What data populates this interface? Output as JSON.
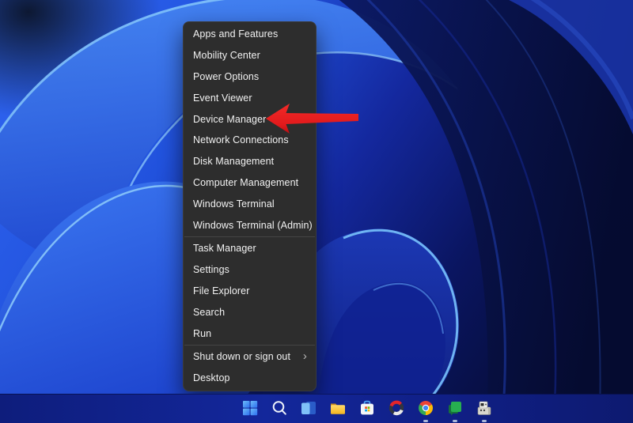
{
  "menu": {
    "items": [
      {
        "label": "Apps and Features"
      },
      {
        "label": "Mobility Center"
      },
      {
        "label": "Power Options"
      },
      {
        "label": "Event Viewer"
      },
      {
        "label": "Device Manager"
      },
      {
        "label": "Network Connections"
      },
      {
        "label": "Disk Management"
      },
      {
        "label": "Computer Management"
      },
      {
        "label": "Windows Terminal"
      },
      {
        "label": "Windows Terminal (Admin)"
      },
      {
        "label": "Task Manager"
      },
      {
        "label": "Settings"
      },
      {
        "label": "File Explorer"
      },
      {
        "label": "Search"
      },
      {
        "label": "Run"
      },
      {
        "label": "Shut down or sign out",
        "chevron": "›"
      },
      {
        "label": "Desktop"
      }
    ]
  },
  "annotation": {
    "arrow_color": "#e8231f",
    "points_at_item": "Device Manager"
  },
  "taskbar": {
    "icons": [
      {
        "name": "start",
        "running": false
      },
      {
        "name": "search",
        "running": false
      },
      {
        "name": "task-view",
        "running": false
      },
      {
        "name": "file-explorer",
        "running": false
      },
      {
        "name": "microsoft-store",
        "running": false
      },
      {
        "name": "ring-app",
        "running": false
      },
      {
        "name": "chrome",
        "running": true
      },
      {
        "name": "google-chat",
        "running": true
      },
      {
        "name": "device-manager",
        "running": true
      }
    ]
  },
  "colors": {
    "menu_background": "#2d2d2d",
    "menu_text": "#f2f2f2",
    "arrow_red": "#e8231f",
    "taskbar_blue": "#13279b",
    "wallpaper_bright_blue": "#2e63ef",
    "wallpaper_dark_navy": "#060d38"
  }
}
